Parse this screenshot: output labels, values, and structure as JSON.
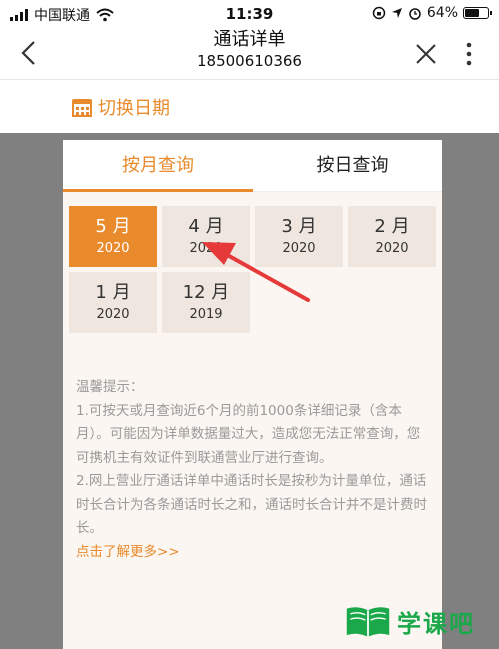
{
  "status_bar": {
    "carrier": "中国联通",
    "time": "11:39",
    "battery": "64%",
    "battery_level": 0.64
  },
  "nav": {
    "back_icon": "chevron-left-icon",
    "title": "通话详单",
    "subtitle": "18500610366",
    "close_icon": "close-icon",
    "more_icon": "more-vertical-icon"
  },
  "date_switch": {
    "icon": "calendar-icon",
    "label": "切换日期"
  },
  "modal": {
    "tabs": [
      {
        "label": "按月查询",
        "active": true
      },
      {
        "label": "按日查询",
        "active": false
      }
    ],
    "months": [
      {
        "month": "5 月",
        "year": "2020",
        "active": true
      },
      {
        "month": "4 月",
        "year": "2020",
        "active": false
      },
      {
        "month": "3 月",
        "year": "2020",
        "active": false
      },
      {
        "month": "2 月",
        "year": "2020",
        "active": false
      },
      {
        "month": "1 月",
        "year": "2020",
        "active": false
      },
      {
        "month": "12 月",
        "year": "2019",
        "active": false
      }
    ],
    "tips": {
      "title": "温馨提示：",
      "items": [
        "1.可按天或月查询近6个月的前1000条详细记录（含本月）。可能因为详单数据量过大，造成您无法正常查询，您可携机主有效证件到联通营业厅进行查询。",
        "2.网上营业厅通话详单中通话时长是按秒为计量单位，通话时长合计为各条通话时长之和，通话时长合计并不是计费时长。"
      ],
      "more_link": "点击了解更多>>"
    }
  },
  "watermark": {
    "logo_text": "学课吧"
  },
  "colors": {
    "accent": "#e98a2c",
    "arrow": "#e63a3a",
    "logo_green": "#1aa84a"
  }
}
